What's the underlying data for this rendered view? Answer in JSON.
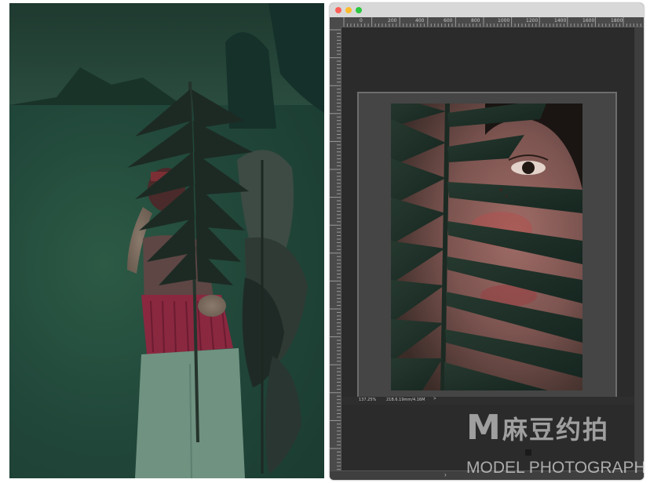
{
  "window": {
    "traffic_lights": {
      "close": "#fc5f57",
      "minimize": "#fdbc2e",
      "maximize": "#2ac840"
    },
    "ruler_top_labels": [
      "0",
      "200",
      "400",
      "600",
      "800",
      "1000",
      "1200",
      "1400",
      "1600",
      "1800"
    ],
    "status_zoom": "137.25%",
    "status_doc": "21B.6.19mm/4.16M",
    "status_arrow": ">",
    "bottom_chevron": "›"
  },
  "watermark": {
    "logo_letter": "M",
    "chinese_text": "麻豆约拍",
    "english_text": "MODEL PHOTOGRAPH",
    "color": "#ffffff"
  },
  "colors": {
    "photo_background": "#21473a",
    "pasteboard": "#2b2b2b",
    "ruler": "#4a4a4a",
    "canvas_frame": "#454545"
  }
}
